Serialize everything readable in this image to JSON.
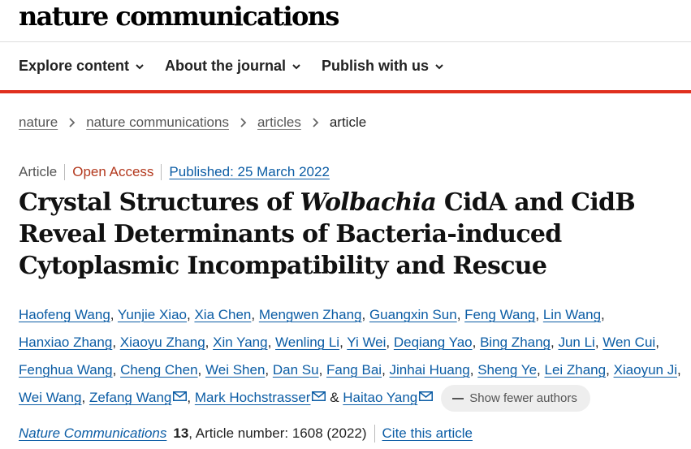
{
  "site": {
    "logo_text": "nature communications"
  },
  "nav": {
    "items": [
      {
        "label": "Explore content"
      },
      {
        "label": "About the journal"
      },
      {
        "label": "Publish with us"
      }
    ]
  },
  "breadcrumb": {
    "items": [
      "nature",
      "nature communications",
      "articles"
    ],
    "current": "article"
  },
  "article": {
    "type": "Article",
    "access": "Open Access",
    "published": "Published: 25 March 2022",
    "title_part1": "Crystal Structures of ",
    "title_italic": "Wolbachia",
    "title_part2": " CidA and CidB Reveal Determinants of Bacteria-induced Cytoplasmic Incompatibility and Rescue",
    "authors": [
      "Haofeng Wang",
      "Yunjie Xiao",
      "Xia Chen",
      "Mengwen Zhang",
      "Guangxin Sun",
      "Feng Wang",
      "Lin Wang",
      "Hanxiao Zhang",
      "Xiaoyu Zhang",
      "Xin Yang",
      "Wenling Li",
      "Yi Wei",
      "Deqiang Yao",
      "Bing Zhang",
      "Jun Li",
      "Wen Cui",
      "Fenghua Wang",
      "Cheng Chen",
      "Wei Shen",
      "Dan Su",
      "Fang Bai",
      "Jinhai Huang",
      "Sheng Ye",
      "Lei Zhang",
      "Xiaoyun Ji",
      "Wei Wang"
    ],
    "corresponding_authors": [
      "Zefang Wang",
      "Mark Hochstrasser",
      "Haitao Yang"
    ],
    "show_fewer_label": "Show fewer authors",
    "journal": "Nature Communications",
    "volume": "13",
    "article_number": ", Article number: 1608 (2022)",
    "cite_label": "Cite this article"
  },
  "colors": {
    "accent": "#e0301e",
    "link": "#0c5da5",
    "open_access": "#b3391e"
  },
  "icons": {
    "nav_chevron": "chevron-down-icon",
    "breadcrumb_sep": "chevron-right-icon",
    "email": "email-icon",
    "collapse": "minus-icon"
  }
}
